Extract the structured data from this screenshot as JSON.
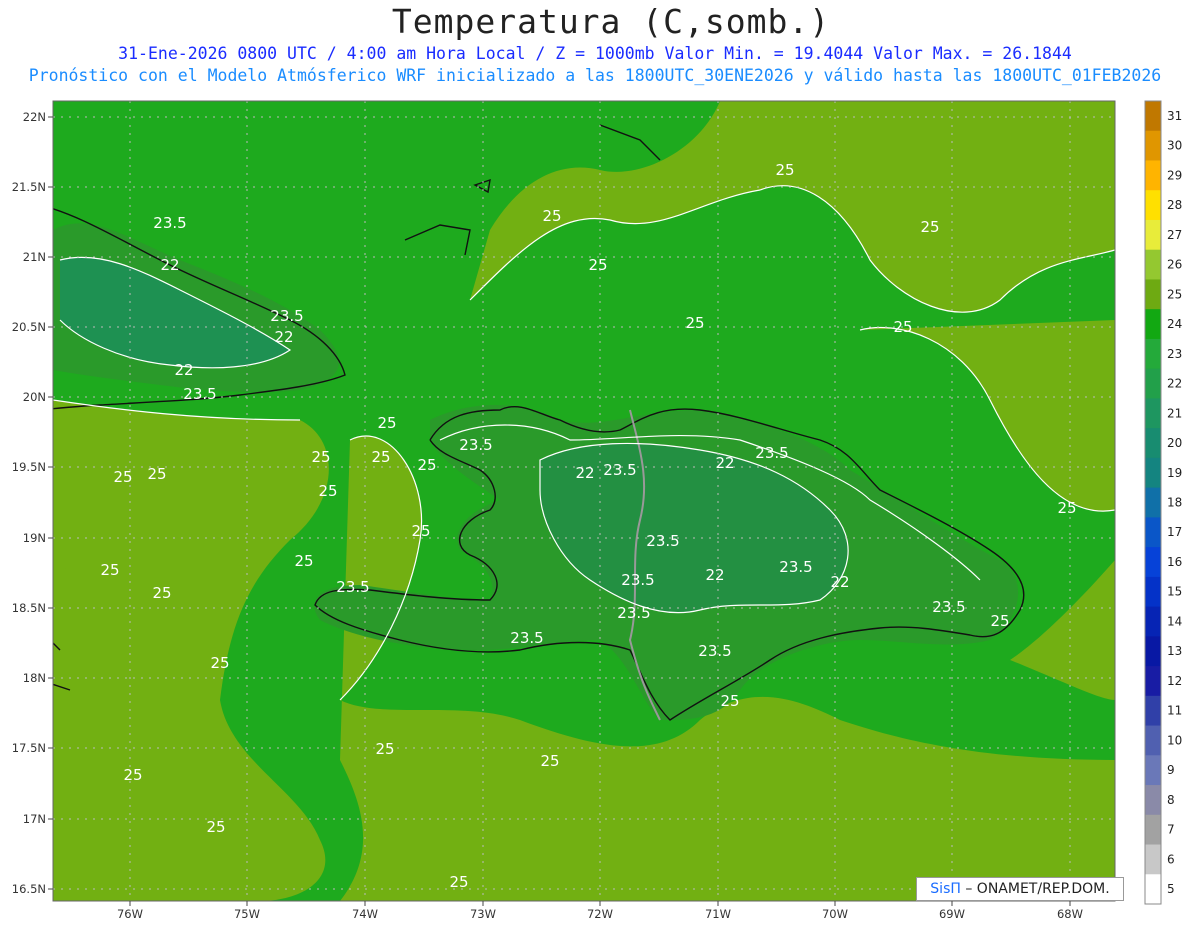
{
  "title": "Temperatura (C,somb.)",
  "subtitle_line1": "31-Ene-2026  0800 UTC / 4:00 am Hora Local / Z = 1000mb   Valor Min. = 19.4044  Valor Max. = 26.1844",
  "subtitle_line2": "Pronóstico con el Modelo Atmósferico WRF inicializado a las 1800UTC_30ENE2026 y válido hasta las  1800UTC_01FEB2026",
  "credit": {
    "logo": "SisΠ",
    "text": "– ONAMET/REP.DOM."
  },
  "map": {
    "x_ticks": [
      "76W",
      "75W",
      "74W",
      "73W",
      "72W",
      "71W",
      "70W",
      "69W",
      "68W"
    ],
    "y_ticks": [
      "22N",
      "21.5N",
      "21N",
      "20.5N",
      "20N",
      "19.5N",
      "19N",
      "18.5N",
      "18N",
      "17.5N",
      "17N",
      "16.5N"
    ],
    "contour_labels": [
      "25",
      "25",
      "25",
      "25",
      "25",
      "25",
      "25",
      "25",
      "25",
      "25",
      "25",
      "25",
      "25",
      "25",
      "25",
      "25",
      "25",
      "25",
      "25",
      "25",
      "25",
      "25",
      "25",
      "25",
      "25",
      "25",
      "23.5",
      "23.5",
      "23.5",
      "23.5",
      "23.5",
      "23.5",
      "23.5",
      "23.5",
      "23.5",
      "23.5",
      "23.5",
      "23.5",
      "23.5",
      "23.5",
      "22",
      "22",
      "22",
      "22",
      "22",
      "22",
      "22"
    ],
    "colors": {
      "land_green": "#2a9a2a",
      "sea_green": "#1eaa1e",
      "olive": "#72b012",
      "coast": "#111111",
      "border": "#999999"
    }
  },
  "colorbar": {
    "labels": [
      "31",
      "30",
      "29",
      "28",
      "27",
      "26",
      "25",
      "24",
      "23",
      "22",
      "21",
      "20",
      "19",
      "18",
      "17",
      "16",
      "15",
      "14",
      "13",
      "12",
      "11",
      "10",
      "9",
      "8",
      "7",
      "6",
      "5"
    ],
    "colors": [
      "#c07800",
      "#e09600",
      "#ffb400",
      "#ffe000",
      "#e8ec3a",
      "#94c830",
      "#6eaa12",
      "#12a812",
      "#24aa3a",
      "#22a04a",
      "#1e9660",
      "#188c70",
      "#148480",
      "#1070a8",
      "#0a56c8",
      "#0642d8",
      "#0432c8",
      "#0624b4",
      "#0818a4",
      "#181ca4",
      "#3040a8",
      "#5060b0",
      "#6a78b8",
      "#8a8aa8",
      "#a2a2a2",
      "#c8c8c8",
      "#ffffff"
    ]
  }
}
